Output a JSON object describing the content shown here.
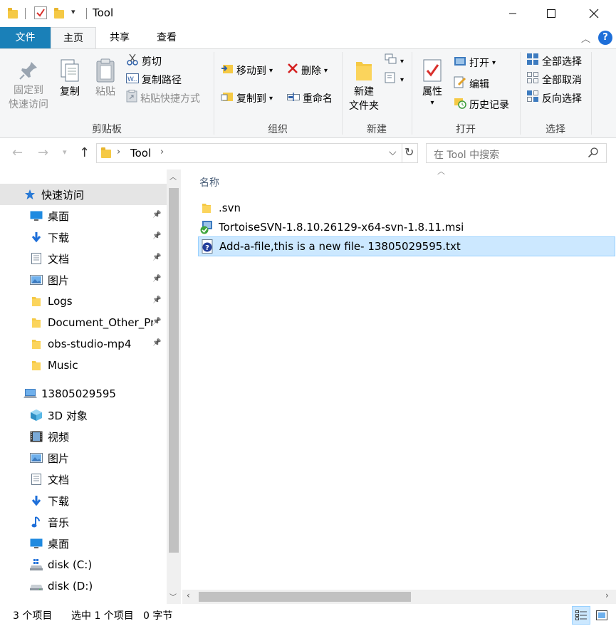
{
  "window": {
    "title": "Tool",
    "minimize_icon": "minimize-icon",
    "maximize_icon": "maximize-icon",
    "close_icon": "close-icon"
  },
  "tabs": [
    {
      "label": "文件"
    },
    {
      "label": "主页"
    },
    {
      "label": "共享"
    },
    {
      "label": "查看"
    }
  ],
  "ribbon": {
    "clipboard": {
      "group_label": "剪贴板",
      "pin_line1": "固定到",
      "pin_line2": "快速访问",
      "copy": "复制",
      "paste": "粘贴",
      "cut": "剪切",
      "copy_path": "复制路径",
      "paste_shortcut": "粘贴快捷方式"
    },
    "organize": {
      "group_label": "组织",
      "move_to": "移动到",
      "copy_to": "复制到",
      "delete": "删除",
      "rename": "重命名"
    },
    "new": {
      "group_label": "新建",
      "new_folder_line1": "新建",
      "new_folder_line2": "文件夹"
    },
    "open": {
      "group_label": "打开",
      "properties": "属性",
      "open": "打开",
      "edit": "编辑",
      "history": "历史记录"
    },
    "select": {
      "group_label": "选择",
      "select_all": "全部选择",
      "select_none": "全部取消",
      "invert": "反向选择"
    }
  },
  "address": {
    "crumb": "Tool",
    "search_placeholder": "在 Tool 中搜索"
  },
  "nav": {
    "quick_access": "快速访问",
    "quick_items": [
      {
        "label": "桌面",
        "icon": "desktop-icon"
      },
      {
        "label": "下载",
        "icon": "download-icon"
      },
      {
        "label": "文档",
        "icon": "document-icon"
      },
      {
        "label": "图片",
        "icon": "pictures-icon"
      },
      {
        "label": "Logs",
        "icon": "folder-icon"
      },
      {
        "label": "Document_Other_Pr",
        "icon": "folder-icon"
      },
      {
        "label": "obs-studio-mp4",
        "icon": "folder-icon"
      },
      {
        "label": "Music",
        "icon": "folder-icon"
      }
    ],
    "this_pc": "13805029595",
    "pc_items": [
      {
        "label": "3D 对象",
        "icon": "3d-objects-icon"
      },
      {
        "label": "视频",
        "icon": "video-icon"
      },
      {
        "label": "图片",
        "icon": "pictures-icon"
      },
      {
        "label": "文档",
        "icon": "document-icon"
      },
      {
        "label": "下载",
        "icon": "download-icon"
      },
      {
        "label": "音乐",
        "icon": "music-icon"
      },
      {
        "label": "桌面",
        "icon": "desktop-icon"
      },
      {
        "label": "disk (C:)",
        "icon": "drive-c-icon"
      },
      {
        "label": "disk (D:)",
        "icon": "drive-d-icon"
      }
    ]
  },
  "list": {
    "column_name": "名称",
    "files": [
      {
        "name": ".svn",
        "icon": "folder-icon"
      },
      {
        "name": "TortoiseSVN-1.8.10.26129-x64-svn-1.8.11.msi",
        "icon": "msi-installer-icon"
      },
      {
        "name": "Add-a-file,this is a new file- 13805029595.txt",
        "icon": "txt-unversioned-icon"
      }
    ]
  },
  "status": {
    "count": "3 个项目",
    "selected": "选中 1 个项目",
    "size": "0 字节"
  },
  "colors": {
    "file_tab": "#1a80b8",
    "selection_bg": "#cce8ff",
    "nav_selected_bg": "#e5e5e5",
    "folder_yellow": "#f5c945",
    "accent_blue": "#1e6fd9"
  }
}
